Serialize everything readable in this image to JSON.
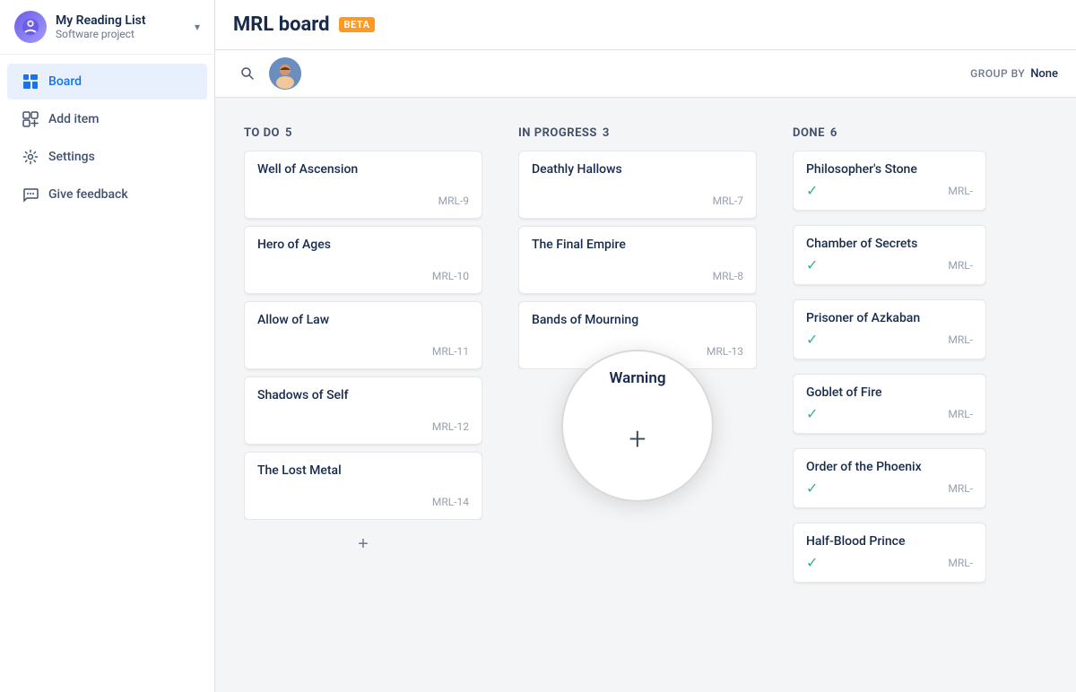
{
  "sidebar": {
    "project_name": "My Reading List",
    "project_sub": "Software project",
    "chevron": "▾",
    "nav_items": [
      {
        "id": "board",
        "label": "Board",
        "active": true
      },
      {
        "id": "add-item",
        "label": "Add item",
        "active": false
      },
      {
        "id": "settings",
        "label": "Settings",
        "active": false
      },
      {
        "id": "give-feedback",
        "label": "Give feedback",
        "active": false
      }
    ]
  },
  "header": {
    "title": "MRL board",
    "beta_label": "BETA"
  },
  "toolbar": {
    "group_by_label": "GROUP BY",
    "group_by_value": "None"
  },
  "columns": [
    {
      "id": "todo",
      "title": "TO DO",
      "count": 5,
      "cards": [
        {
          "id": "card-1",
          "title": "Well of Ascension",
          "code": "MRL-9"
        },
        {
          "id": "card-2",
          "title": "Hero of Ages",
          "code": "MRL-10"
        },
        {
          "id": "card-3",
          "title": "Allow of Law",
          "code": "MRL-11"
        },
        {
          "id": "card-4",
          "title": "Shadows of Self",
          "code": "MRL-12"
        },
        {
          "id": "card-5",
          "title": "The Lost Metal",
          "code": "MRL-14"
        }
      ]
    },
    {
      "id": "inprogress",
      "title": "IN PROGRESS",
      "count": 3,
      "cards": [
        {
          "id": "card-6",
          "title": "Deathly Hallows",
          "code": "MRL-7"
        },
        {
          "id": "card-7",
          "title": "The Final Empire",
          "code": "MRL-8"
        },
        {
          "id": "card-8",
          "title": "Bands of Mourning",
          "code": "MRL-13"
        }
      ]
    },
    {
      "id": "done",
      "title": "DONE",
      "count": 6,
      "cards": [
        {
          "id": "card-9",
          "title": "Philosopher's Stone",
          "code": "MRL-"
        },
        {
          "id": "card-10",
          "title": "Chamber of Secrets",
          "code": "MRL-"
        },
        {
          "id": "card-11",
          "title": "Prisoner of Azkaban",
          "code": "MRL-"
        },
        {
          "id": "card-12",
          "title": "Goblet of Fire",
          "code": "MRL-"
        },
        {
          "id": "card-13",
          "title": "Order of the Phoenix",
          "code": "MRL-"
        },
        {
          "id": "card-14",
          "title": "Half-Blood Prince",
          "code": "MRL-"
        }
      ]
    }
  ],
  "spotlight": {
    "warning_text": "Warning",
    "plus_symbol": "+"
  },
  "icons": {
    "board": "▦",
    "add": "⊞",
    "settings": "⚙",
    "feedback": "📣",
    "search": "🔍",
    "check": "✓"
  }
}
